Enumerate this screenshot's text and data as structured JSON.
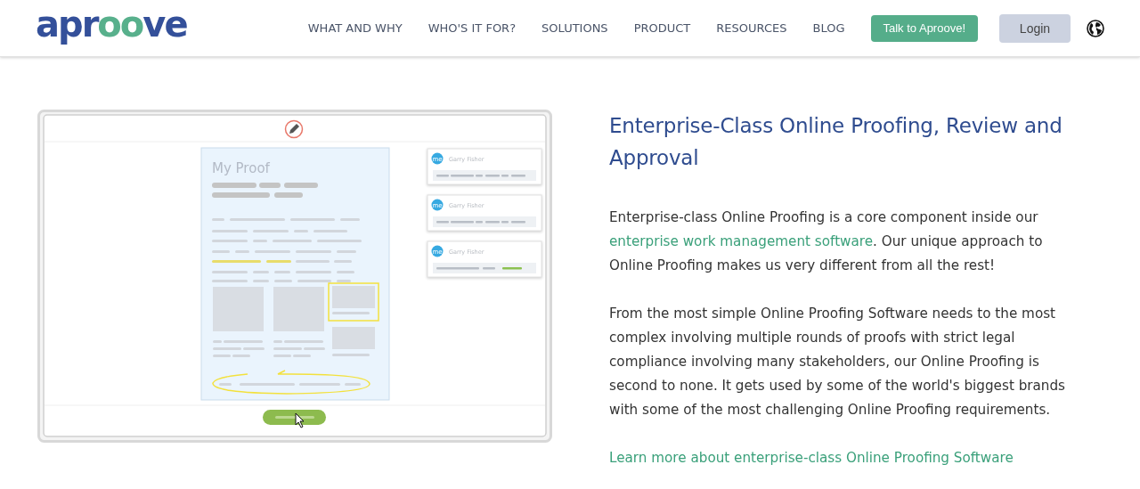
{
  "header": {
    "logo": [
      "apr",
      "oo",
      "ve"
    ],
    "nav": [
      "WHAT AND WHY",
      "WHO'S IT FOR?",
      "SOLUTIONS",
      "PRODUCT",
      "RESOURCES",
      "BLOG"
    ],
    "cta": "Talk to Aproove!",
    "login": "Login"
  },
  "illustration": {
    "proof_title": "My Proof",
    "comments": [
      {
        "avatar": "me",
        "name": "Garry Fisher"
      },
      {
        "avatar": "me",
        "name": "Garry Fisher"
      },
      {
        "avatar": "me",
        "name": "Garry Fisher"
      }
    ]
  },
  "article": {
    "title": "Enterprise-Class Online Proofing, Review and Approval",
    "intro": {
      "before": "Enterprise-class Online Proofing is a core component inside our ",
      "link": "enterprise work management software",
      "after": ". Our unique approach to Online Proofing makes us very different from all the rest!"
    },
    "paragraph": "From the most simple Online Proofing Software needs to the most complex involving multiple rounds of proofs with strict legal compliance involving many stakeholders, our Online Proofing is second to none. It gets used by some of the world's biggest brands with some of the most challenging Online Proofing requirements.",
    "more_link": "Learn more about enterprise-class Online Proofing Software"
  }
}
